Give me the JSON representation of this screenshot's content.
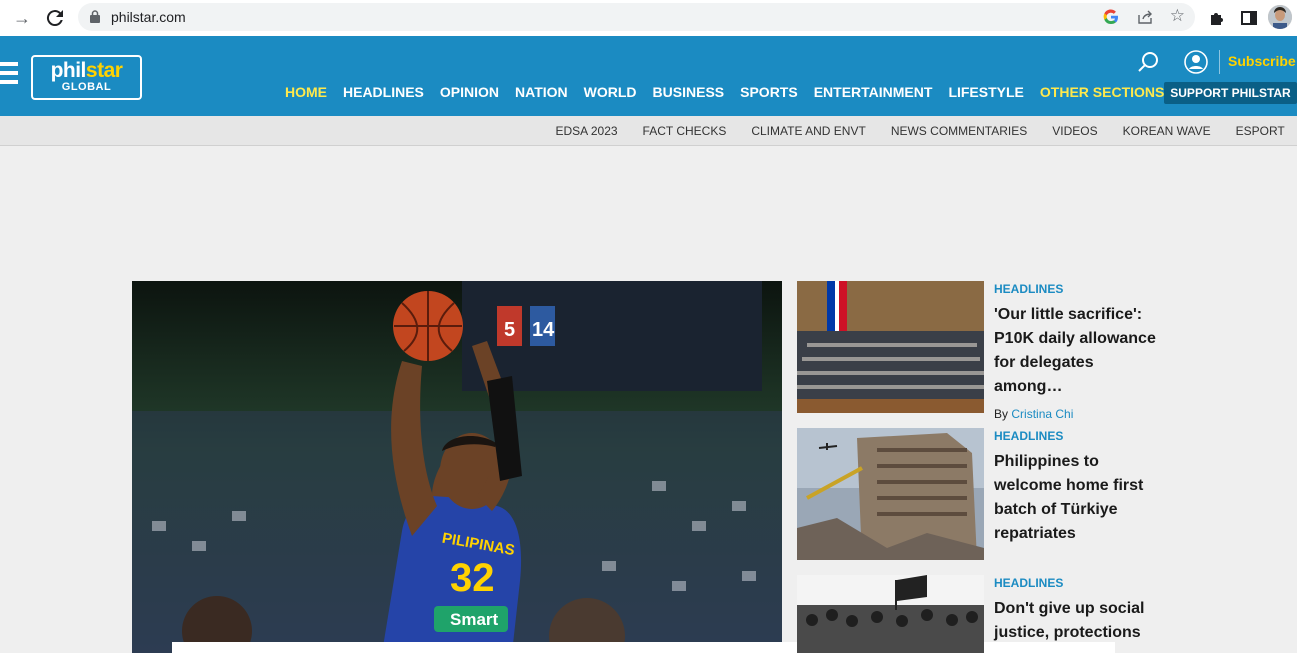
{
  "browser": {
    "url": "philstar.com",
    "back_icon": "arrow-right-icon",
    "reload_icon": "reload-icon"
  },
  "header": {
    "logo_top_a": "phil",
    "logo_top_b": "star",
    "logo_bottom": "GLOBAL",
    "subscribe_label": "Subscribe",
    "support_label": "SUPPORT PHILSTAR",
    "accent_color": "#ffe94d",
    "brand_color": "#1b8bc2"
  },
  "main_nav": [
    "HOME",
    "HEADLINES",
    "OPINION",
    "NATION",
    "WORLD",
    "BUSINESS",
    "SPORTS",
    "ENTERTAINMENT",
    "LIFESTYLE",
    "OTHER SECTIONS"
  ],
  "sub_nav": [
    "EDSA 2023",
    "FACT CHECKS",
    "CLIMATE AND ENVT",
    "NEWS COMMENTARIES",
    "VIDEOS",
    "KOREAN WAVE",
    "ESPORT"
  ],
  "stories": [
    {
      "category": "HEADLINES",
      "title": "'Our little sacrifice': P10K daily allowance for delegates among…",
      "by": "By",
      "author": "Cristina Chi"
    },
    {
      "category": "HEADLINES",
      "title": "Philippines to welcome home first batch of Türkiye repatriates"
    },
    {
      "category": "HEADLINES",
      "title": "Don't give up social justice, protections"
    }
  ],
  "hero": {
    "jersey_text": "PILIPINAS",
    "jersey_number": "32",
    "sponsor": "Smart",
    "scoreboard_a": "5",
    "scoreboard_b": "14"
  }
}
